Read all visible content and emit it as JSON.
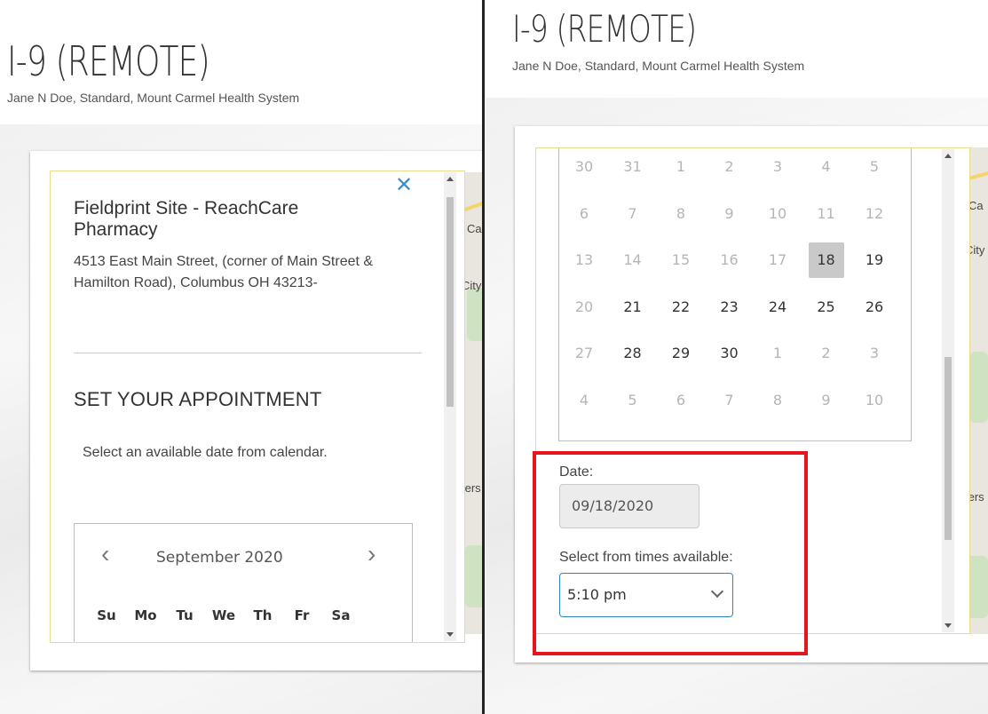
{
  "header": {
    "title": "I-9 (REMOTE)",
    "subtitle": "Jane N Doe, Standard, Mount Carmel Health System"
  },
  "site": {
    "name": "Fieldprint Site - ReachCare Pharmacy",
    "address": "4513 East Main Street, (corner of Main Street & Hamilton Road), Columbus OH 43213-"
  },
  "appointment": {
    "section_title": "SET YOUR APPOINTMENT",
    "instructions": "Select an available date from calendar."
  },
  "calendar": {
    "month_label": "September 2020",
    "prev_icon": "chevron-left-icon",
    "next_icon": "chevron-right-icon",
    "weekdays": [
      "Su",
      "Mo",
      "Tu",
      "We",
      "Th",
      "Fr",
      "Sa"
    ],
    "weeks": [
      [
        {
          "d": "30",
          "s": "muted"
        },
        {
          "d": "31",
          "s": "muted"
        },
        {
          "d": "1",
          "s": "muted"
        },
        {
          "d": "2",
          "s": "muted"
        },
        {
          "d": "3",
          "s": "muted"
        },
        {
          "d": "4",
          "s": "muted"
        },
        {
          "d": "5",
          "s": "muted"
        }
      ],
      [
        {
          "d": "6",
          "s": "muted"
        },
        {
          "d": "7",
          "s": "muted"
        },
        {
          "d": "8",
          "s": "muted"
        },
        {
          "d": "9",
          "s": "muted"
        },
        {
          "d": "10",
          "s": "muted"
        },
        {
          "d": "11",
          "s": "muted"
        },
        {
          "d": "12",
          "s": "muted"
        }
      ],
      [
        {
          "d": "13",
          "s": "muted"
        },
        {
          "d": "14",
          "s": "muted"
        },
        {
          "d": "15",
          "s": "muted"
        },
        {
          "d": "16",
          "s": "muted"
        },
        {
          "d": "17",
          "s": "muted"
        },
        {
          "d": "18",
          "s": "selected"
        },
        {
          "d": "19",
          "s": "avail"
        }
      ],
      [
        {
          "d": "20",
          "s": "muted"
        },
        {
          "d": "21",
          "s": "avail"
        },
        {
          "d": "22",
          "s": "avail"
        },
        {
          "d": "23",
          "s": "avail"
        },
        {
          "d": "24",
          "s": "avail"
        },
        {
          "d": "25",
          "s": "avail"
        },
        {
          "d": "26",
          "s": "avail"
        }
      ],
      [
        {
          "d": "27",
          "s": "muted"
        },
        {
          "d": "28",
          "s": "avail"
        },
        {
          "d": "29",
          "s": "avail"
        },
        {
          "d": "30",
          "s": "avail"
        },
        {
          "d": "1",
          "s": "muted"
        },
        {
          "d": "2",
          "s": "muted"
        },
        {
          "d": "3",
          "s": "muted"
        }
      ],
      [
        {
          "d": "4",
          "s": "muted"
        },
        {
          "d": "5",
          "s": "muted"
        },
        {
          "d": "6",
          "s": "muted"
        },
        {
          "d": "7",
          "s": "muted"
        },
        {
          "d": "8",
          "s": "muted"
        },
        {
          "d": "9",
          "s": "muted"
        },
        {
          "d": "10",
          "s": "muted"
        }
      ]
    ]
  },
  "form": {
    "date_label": "Date:",
    "date_value": "09/18/2020",
    "time_label": "Select from times available:",
    "time_value": "5:10 pm"
  },
  "map_labels": {
    "ca": "Ca",
    "city": "City",
    "fers": "fers"
  },
  "icons": {
    "close": "close-icon",
    "dropdown": "chevron-down-icon"
  },
  "colors": {
    "accent_blue": "#3b8fd1",
    "panel_border": "#e8dc8a",
    "highlight_red": "#e8141b",
    "selected_day": "#c9c9c9"
  }
}
